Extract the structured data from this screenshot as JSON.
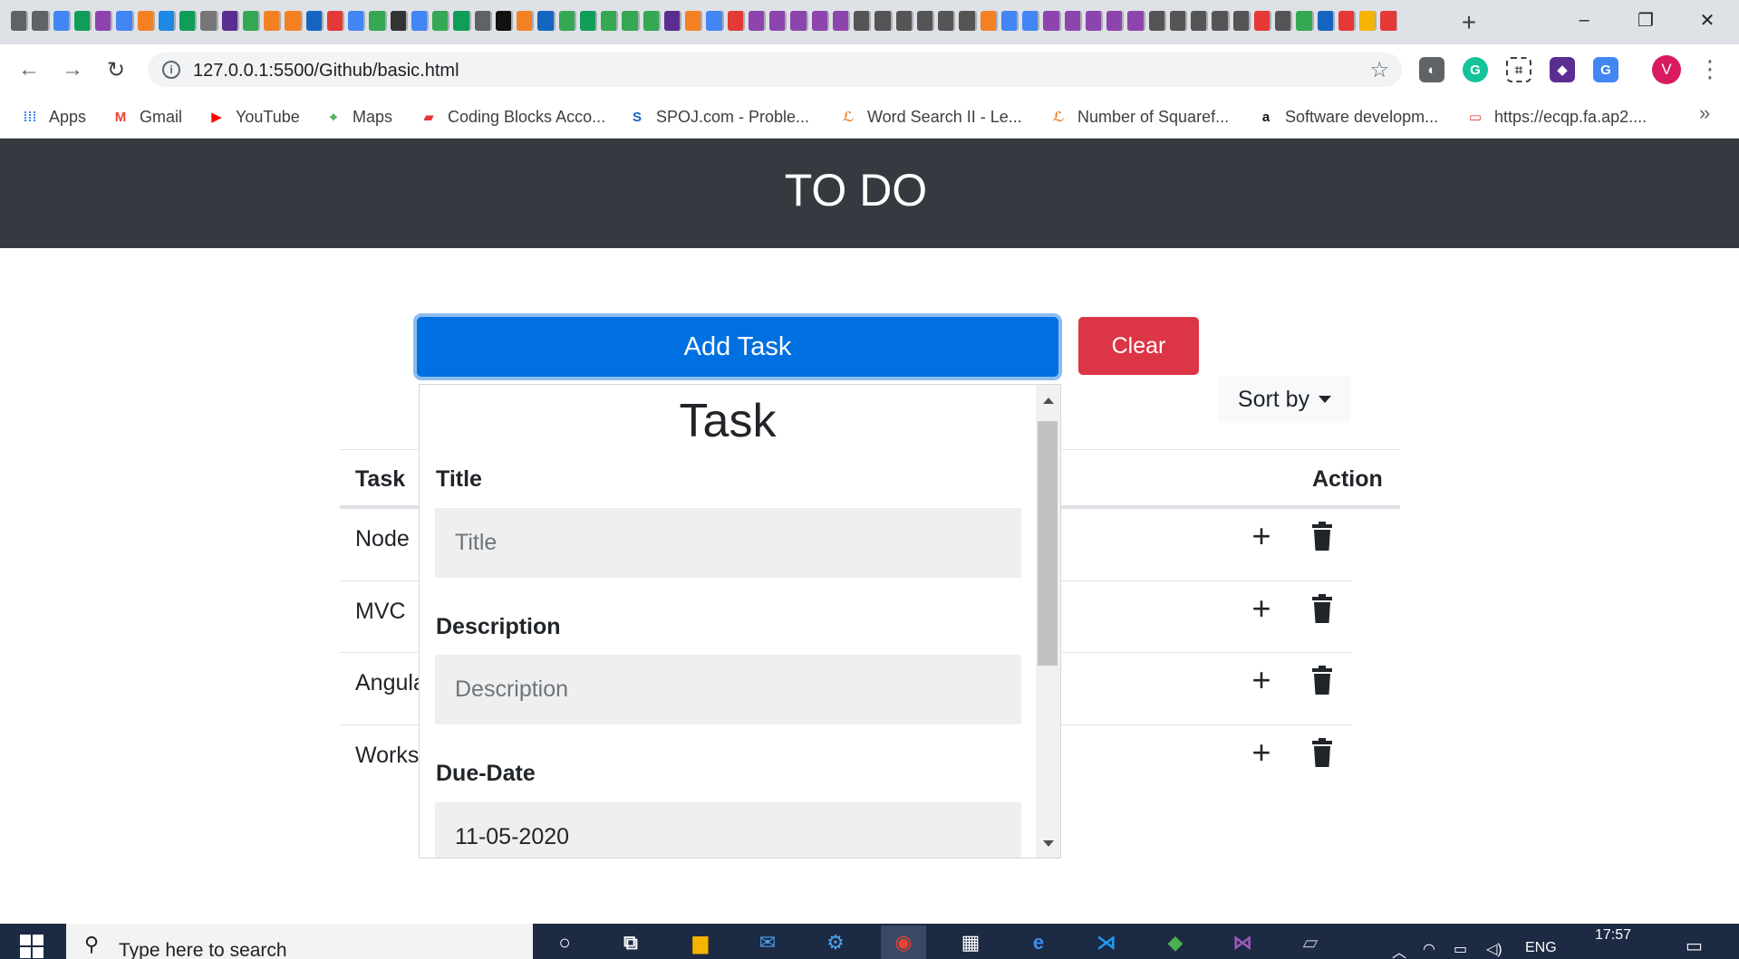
{
  "browser": {
    "tab_icon_colors": [
      "#5f6368",
      "#5f6368",
      "#4285f4",
      "#0f9d58",
      "#8e44ad",
      "#4285f4",
      "#f48024",
      "#1e88e5",
      "#0f9d58",
      "#777777",
      "#5c2d91",
      "#34a853",
      "#f48024",
      "#f48024",
      "#1565c0",
      "#e53935",
      "#4285f4",
      "#34a853",
      "#333333",
      "#4285f4",
      "#34a853",
      "#0f9d58",
      "#5f6368",
      "#111111",
      "#f48024",
      "#1565c0",
      "#34a853",
      "#0f9d58",
      "#34a853",
      "#34a853",
      "#34a853",
      "#5c2d91",
      "#f48024",
      "#4285f4",
      "#e53935",
      "#8e44ad",
      "#8e44ad",
      "#8e44ad",
      "#8e44ad",
      "#8e44ad",
      "#555555",
      "#555555",
      "#555555",
      "#555555",
      "#555555",
      "#555555",
      "#f48024",
      "#4285f4",
      "#4285f4",
      "#8e44ad",
      "#8e44ad",
      "#8e44ad",
      "#8e44ad",
      "#8e44ad",
      "#555555",
      "#555555",
      "#555555",
      "#555555",
      "#555555",
      "#e53935",
      "#555555",
      "#34a853",
      "#1565c0",
      "#e53935",
      "#f4b400",
      "#e53935"
    ],
    "new_tab_icon": "plus-icon",
    "window_controls": {
      "minimize": "–",
      "maximize": "❐",
      "close": "✕"
    },
    "url": "127.0.0.1:5500/Github/basic.html",
    "profile_initial": "V",
    "bookmarks": [
      {
        "label": "Apps",
        "icon": "apps-grid-icon",
        "color": "#4285f4"
      },
      {
        "label": "Gmail",
        "icon": "gmail-icon",
        "color": "#ea4335"
      },
      {
        "label": "YouTube",
        "icon": "youtube-icon",
        "color": "#ff0000"
      },
      {
        "label": "Maps",
        "icon": "maps-icon",
        "color": "#34a853"
      },
      {
        "label": "Coding Blocks Acco...",
        "icon": "coding-blocks-icon",
        "color": "#e53935"
      },
      {
        "label": "SPOJ.com - Proble...",
        "icon": "spoj-icon",
        "color": "#1565c0"
      },
      {
        "label": "Word Search II - Le...",
        "icon": "leetcode-icon",
        "color": "#f48024"
      },
      {
        "label": "Number of Squaref...",
        "icon": "leetcode-icon",
        "color": "#f48024"
      },
      {
        "label": "Software developm...",
        "icon": "amazon-icon",
        "color": "#111111"
      },
      {
        "label": "https://ecqp.fa.ap2....",
        "icon": "oracle-icon",
        "color": "#e53935"
      }
    ],
    "bookmarks_more": "»"
  },
  "app": {
    "title": "TO DO",
    "add_task_label": "Add Task",
    "clear_label": "Clear",
    "sort_label": "Sort by",
    "table": {
      "headers": {
        "task": "Task",
        "action": "Action"
      },
      "rows": [
        "Node",
        "MVC",
        "Angula",
        "Works"
      ]
    },
    "popup": {
      "title": "Task",
      "title_label": "Title",
      "title_placeholder": "Title",
      "description_label": "Description",
      "description_placeholder": "Description",
      "due_label": "Due-Date",
      "due_value": "11-05-2020"
    }
  },
  "taskbar": {
    "search_placeholder": "Type here to search",
    "language": "ENG",
    "time": "17:57"
  }
}
